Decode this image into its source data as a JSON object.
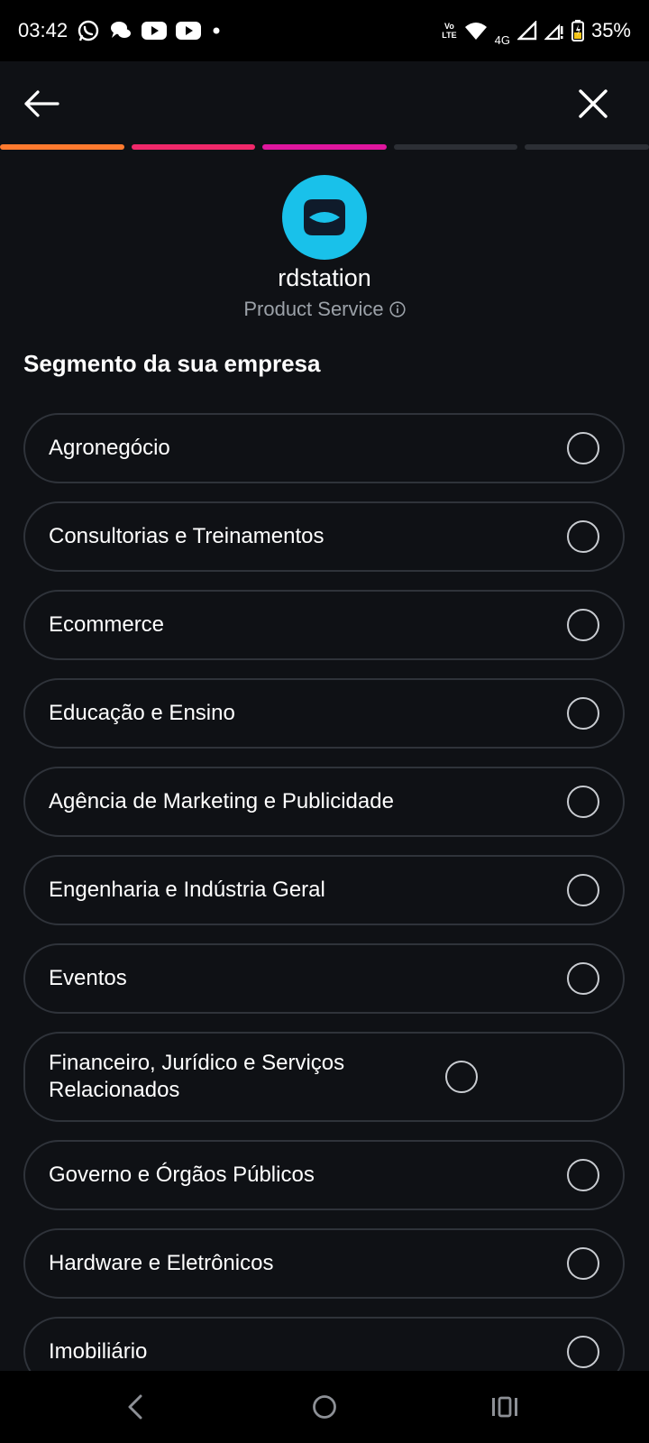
{
  "status_bar": {
    "time": "03:42",
    "network": "4G",
    "volte_top": "Vo",
    "volte_bottom": "LTE",
    "battery": "35%"
  },
  "header": {
    "brand_name": "rdstation",
    "subtitle": "Product Service",
    "section_title": "Segmento da sua empresa"
  },
  "progress": {
    "steps": 5,
    "completed": 3,
    "colors": [
      "#ff7a2f",
      "#f0286a",
      "#e0169e",
      "#2c2f35",
      "#2c2f35"
    ]
  },
  "colors": {
    "background": "#0f1115",
    "logo": "#19c1ea",
    "border": "#2f333a"
  },
  "options": [
    {
      "label": "Agronegócio"
    },
    {
      "label": "Consultorias e Treinamentos"
    },
    {
      "label": "Ecommerce"
    },
    {
      "label": "Educação e Ensino"
    },
    {
      "label": "Agência de Marketing e Publicidade"
    },
    {
      "label": "Engenharia e Indústria Geral"
    },
    {
      "label": "Eventos"
    },
    {
      "label": "Financeiro, Jurídico e Serviços Relacionados"
    },
    {
      "label": "Governo e Órgãos Públicos"
    },
    {
      "label": "Hardware e Eletrônicos"
    },
    {
      "label": "Imobiliário"
    }
  ]
}
